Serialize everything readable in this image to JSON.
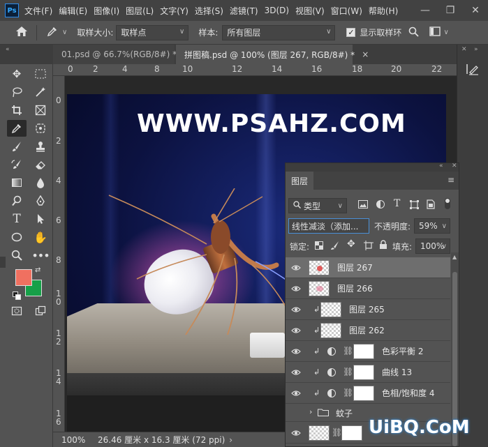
{
  "menubar": {
    "logo": "Ps",
    "items": [
      "文件(F)",
      "编辑(E)",
      "图像(I)",
      "图层(L)",
      "文字(Y)",
      "选择(S)",
      "滤镜(T)",
      "3D(D)",
      "视图(V)",
      "窗口(W)",
      "帮助(H)"
    ],
    "window_controls": [
      "—",
      "❐",
      "✕"
    ]
  },
  "optionsbar": {
    "sample_size_label": "取样大小:",
    "sample_size_value": "取样点",
    "sample_label": "样本:",
    "sample_value": "所有图层",
    "show_ring_label": "显示取样环"
  },
  "tabs": [
    {
      "label": "01.psd @ 66.7%(RGB/8#) *",
      "close": "×"
    },
    {
      "label": "拼图稿.psd @ 100% (图层 267, RGB/8#) *",
      "close": "×"
    }
  ],
  "ruler": {
    "top_ticks": [
      "0",
      "2",
      "4",
      "6",
      "8",
      "10",
      "12",
      "14",
      "16",
      "18",
      "20",
      "22"
    ],
    "left_ticks": [
      "0",
      "2",
      "4",
      "6",
      "8",
      "1\n0",
      "1\n2",
      "1\n4",
      "1\n6"
    ]
  },
  "canvas": {
    "watermark": "WWW.PSAHZ.COM"
  },
  "statusbar": {
    "zoom": "100%",
    "doc_size": "26.46 厘米 x 16.3 厘米 (72 ppi)",
    "arrow": "›"
  },
  "colors": {
    "foreground": "#f07060",
    "background": "#16a048",
    "accent": "#31a8ff"
  },
  "layers_panel": {
    "tab": "图层",
    "filter_type": "类型",
    "blend_mode": "线性减淡（添加...",
    "opacity_label": "不透明度:",
    "opacity_value": "59%",
    "lock_label": "锁定:",
    "fill_label": "填充:",
    "fill_value": "100%",
    "layers": [
      {
        "name": "图层 267",
        "kind": "pixel",
        "clipped": false,
        "selected": true
      },
      {
        "name": "图层 266",
        "kind": "pixel",
        "clipped": false,
        "selected": false
      },
      {
        "name": "图层 265",
        "kind": "pixel",
        "clipped": true,
        "selected": false
      },
      {
        "name": "图层 262",
        "kind": "pixel",
        "clipped": true,
        "selected": false
      },
      {
        "name": "色彩平衡 2",
        "kind": "adjustment",
        "clipped": true,
        "selected": false
      },
      {
        "name": "曲线 13",
        "kind": "adjustment",
        "clipped": true,
        "selected": false
      },
      {
        "name": "色相/饱和度 4",
        "kind": "adjustment",
        "clipped": true,
        "selected": false
      },
      {
        "name": "蚊子",
        "kind": "group",
        "clipped": false,
        "selected": false
      },
      {
        "name": "",
        "kind": "masked",
        "clipped": false,
        "selected": false
      }
    ]
  },
  "brand": "UiBQ.CoM"
}
